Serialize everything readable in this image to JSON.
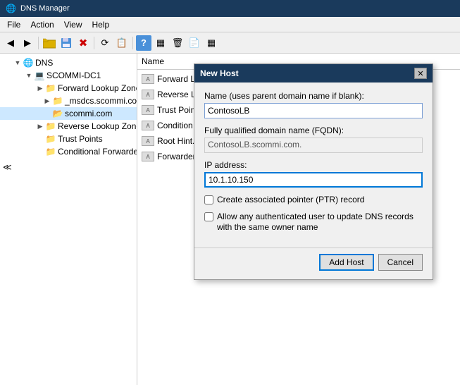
{
  "titleBar": {
    "title": "DNS Manager",
    "icon": "🌐"
  },
  "menuBar": {
    "items": [
      "File",
      "Action",
      "View",
      "Help"
    ]
  },
  "toolbar": {
    "buttons": [
      "◀",
      "▶",
      "📁",
      "💾",
      "✖",
      "⟳",
      "📋",
      "🔍",
      "?",
      "▦",
      "🗑",
      "📄",
      "▦"
    ]
  },
  "treePanel": {
    "header": "DNS",
    "items": [
      {
        "label": "DNS",
        "level": 0,
        "type": "root",
        "expanded": true
      },
      {
        "label": "SCOMMI-DC1",
        "level": 1,
        "type": "computer",
        "expanded": true
      },
      {
        "label": "Forward Lookup Zones",
        "level": 2,
        "type": "folder",
        "expanded": true
      },
      {
        "label": "_msdcs.scommi.com",
        "level": 3,
        "type": "folder",
        "expanded": false
      },
      {
        "label": "scommi.com",
        "level": 3,
        "type": "folder-open",
        "expanded": true,
        "selected": true
      },
      {
        "label": "Reverse Lookup Zones",
        "level": 2,
        "type": "folder",
        "expanded": false
      },
      {
        "label": "Trust Points",
        "level": 2,
        "type": "folder",
        "expanded": false
      },
      {
        "label": "Conditional Forwarders",
        "level": 2,
        "type": "folder",
        "expanded": false
      }
    ]
  },
  "rightPanel": {
    "header": "Name",
    "items": [
      {
        "label": "Forward L..."
      },
      {
        "label": "Reverse L..."
      },
      {
        "label": "Trust Poin..."
      },
      {
        "label": "Condition"
      },
      {
        "label": "Root Hint..."
      },
      {
        "label": "Forwarder..."
      }
    ]
  },
  "modal": {
    "title": "New Host",
    "closeBtn": "✕",
    "nameLabel": "Name (uses parent domain name if blank):",
    "nameValue": "ContosoLB",
    "fqdnLabel": "Fully qualified domain name (FQDN):",
    "fqdnValue": "ContosoLB.scommi.com.",
    "ipLabel": "IP address:",
    "ipValue": "10.1.10.150",
    "checkbox1Label": "Create associated pointer (PTR) record",
    "checkbox2Label": "Allow any authenticated user to update DNS records with the same owner name",
    "checkbox1Checked": false,
    "checkbox2Checked": false,
    "addHostBtn": "Add Host",
    "cancelBtn": "Cancel"
  },
  "bottomNav": {
    "arrows": "≪"
  }
}
